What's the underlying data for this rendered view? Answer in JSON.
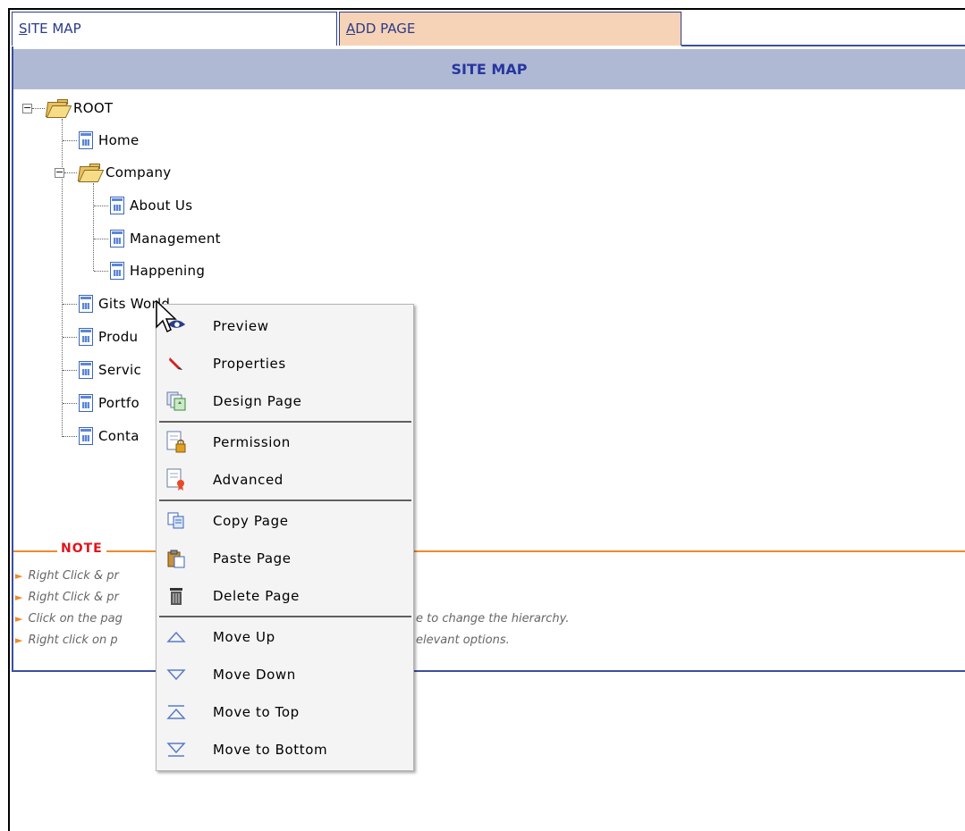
{
  "tabs": {
    "sitemap_label_u": "S",
    "sitemap_label_rest": "ITE MAP",
    "add_label_u": "A",
    "add_label_rest": "DD PAGE"
  },
  "panel": {
    "title": "SITE MAP"
  },
  "tree": {
    "root": "ROOT",
    "home": "Home",
    "company": "Company",
    "about": "About Us",
    "management": "Management",
    "happening": "Happening",
    "gits": "Gits World",
    "products": "Produ",
    "services": "Servic",
    "portfolio": "Portfo",
    "contact": "Conta"
  },
  "note": {
    "title": "NOTE",
    "items": [
      "Right Click & pr",
      "Right Click & pr",
      "Click on the pag",
      "Right click on p"
    ],
    "tails": [
      "",
      "",
      "e to change the hierarchy.",
      "elevant options."
    ]
  },
  "context_menu": {
    "preview": "Preview",
    "properties": "Properties",
    "design": "Design Page",
    "permission": "Permission",
    "advanced": "Advanced",
    "copy": "Copy Page",
    "paste": "Paste Page",
    "delete": "Delete Page",
    "move_up": "Move Up",
    "move_down": "Move Down",
    "move_top": "Move to Top",
    "move_bottom": "Move to Bottom"
  },
  "colors": {
    "tab_border": "#2e3f8f",
    "header_bg": "#b0b9d4",
    "header_text": "#2636a0",
    "add_tab_bg": "#f6d3b6",
    "note_line": "#f08a2a",
    "note_title": "#e0141a"
  }
}
